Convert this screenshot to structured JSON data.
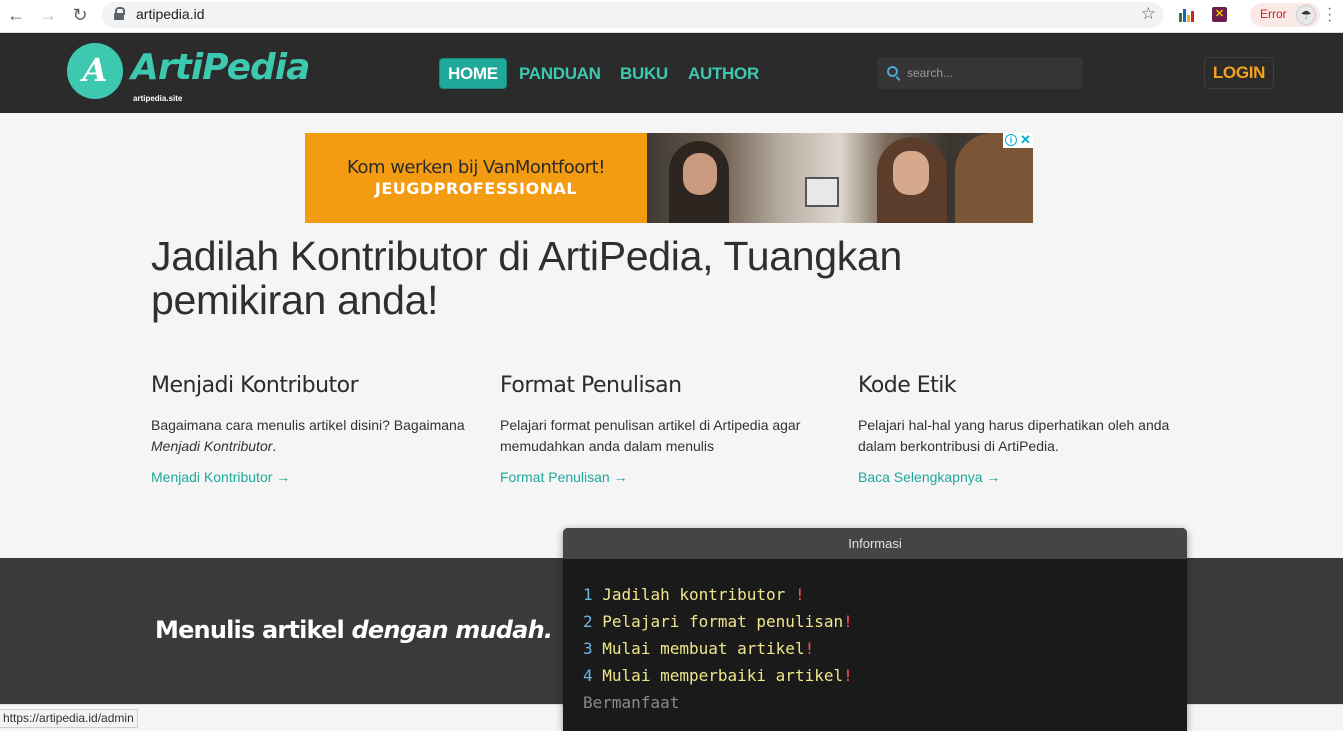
{
  "browser": {
    "url": "artipedia.id",
    "extension_status": "Error",
    "status_url": "https://artipedia.id/admin"
  },
  "site": {
    "logo_letter": "A",
    "logo_text": "ArtiPedia",
    "logo_sub": "artipedia.site",
    "nav": [
      "HOME",
      "PANDUAN",
      "BUKU",
      "AUTHOR"
    ],
    "search_placeholder": "search...",
    "login": "LOGIN"
  },
  "ad": {
    "line1": "Kom werken bij VanMontfoort!",
    "line2": "JEUGDPROFESSIONAL"
  },
  "hero": {
    "title": "Jadilah Kontributor di ArtiPedia, Tuangkan pemikiran anda!"
  },
  "features": [
    {
      "title": "Menjadi Kontributor",
      "desc_plain": "Bagaimana cara menulis artikel disini? Bagaimana ",
      "desc_em": "Menjadi Kontributor",
      "desc_end": ".",
      "link": "Menjadi Kontributor →"
    },
    {
      "title": "Format Penulisan",
      "desc_plain": "Pelajari format penulisan artikel di Artipedia agar memudahkan anda dalam menulis",
      "desc_em": "",
      "desc_end": "",
      "link": "Format Penulisan →"
    },
    {
      "title": "Kode Etik",
      "desc_plain": "Pelajari hal-hal yang harus diperhatikan oleh anda dalam berkontribusi di ArtiPedia.",
      "desc_em": "",
      "desc_end": "",
      "link": "Baca Selengkapnya →"
    }
  ],
  "band": {
    "tag_plain": "Menulis artikel ",
    "tag_em": "dengan  mudah."
  },
  "info": {
    "title": "Informasi",
    "lines": [
      {
        "num": "1",
        "text": "Jadilah kontributor ",
        "bang": "!"
      },
      {
        "num": "2",
        "text": "Pelajari format penulisan",
        "bang": "!"
      },
      {
        "num": "3",
        "text": "Mulai membuat artikel",
        "bang": "!"
      },
      {
        "num": "4",
        "text": "Mulai memperbaiki artikel",
        "bang": "!"
      }
    ],
    "footer": "Bermanfaat"
  },
  "colors": {
    "accent": "#3cc9b0",
    "navbar": "#2b2b2b",
    "login": "#f5a21a",
    "ad_bg": "#f39c12"
  }
}
